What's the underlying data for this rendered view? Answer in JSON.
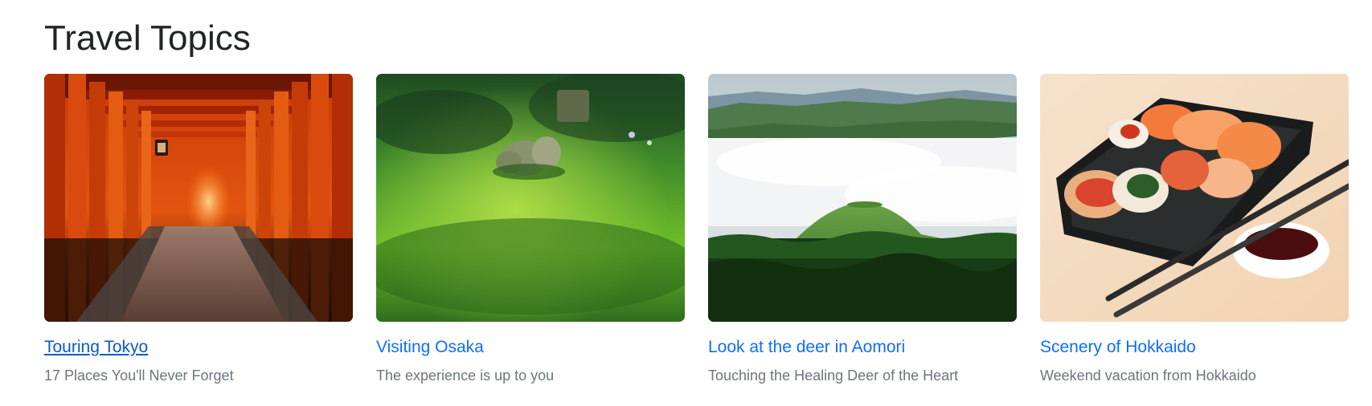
{
  "section": {
    "title": "Travel Topics"
  },
  "cards": [
    {
      "title": "Touring Tokyo",
      "subtitle": "17 Places You'll Never Forget",
      "image": "torii-gates-tunnel-photo",
      "active": true
    },
    {
      "title": "Visiting Osaka",
      "subtitle": "The experience is up to you",
      "image": "mossy-garden-statues-photo",
      "active": false
    },
    {
      "title": "Look at the deer in Aomori",
      "subtitle": "Touching the Healing Deer of the Heart",
      "image": "green-hill-sea-of-clouds-photo",
      "active": false
    },
    {
      "title": "Scenery of Hokkaido",
      "subtitle": "Weekend vacation from Hokkaido",
      "image": "sushi-tray-chopsticks-photo",
      "active": false
    }
  ],
  "colors": {
    "heading": "#212529",
    "link": "#0d6efd",
    "link_hover": "#0a58ca",
    "muted": "#6c757d"
  }
}
